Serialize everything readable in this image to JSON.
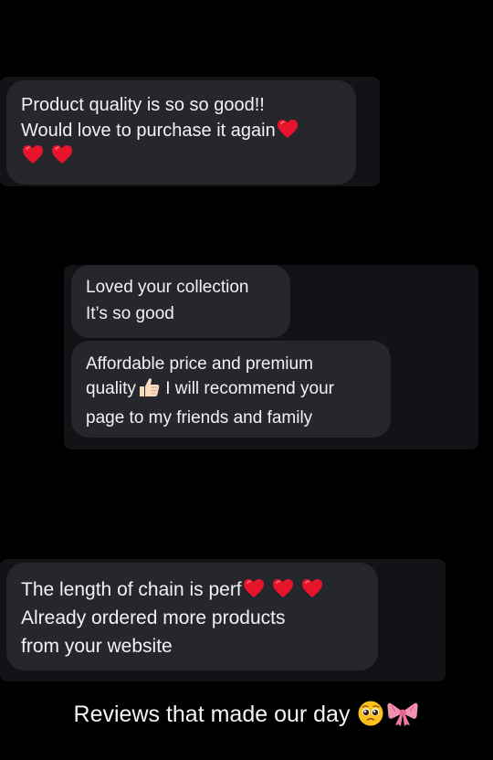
{
  "messages": [
    {
      "lines": [
        "Product quality is so so good!!",
        "Would love to purchase it again"
      ],
      "emoji": [
        "red-heart",
        "red-heart",
        "red-heart"
      ]
    },
    {
      "lines": [
        "Loved your collection",
        "It’s so good"
      ]
    },
    {
      "lines": [
        "Affordable price and premium",
        "quality",
        " I will recommend your",
        "page to my friends and family"
      ],
      "emoji": [
        "thumbs-up"
      ]
    },
    {
      "lines": [
        "The length of chain is perf",
        "Already ordered more products",
        "from your website"
      ],
      "emoji": [
        "red-heart",
        "red-heart",
        "red-heart"
      ]
    }
  ],
  "caption": {
    "text": "Reviews that made our day",
    "emoji": [
      "pleading-face",
      "ribbon"
    ]
  },
  "colors": {
    "background": "#000000",
    "panel": "#121317",
    "bubble": "#26272c",
    "text": "#f2f2f2",
    "heart": "#e8142c"
  }
}
